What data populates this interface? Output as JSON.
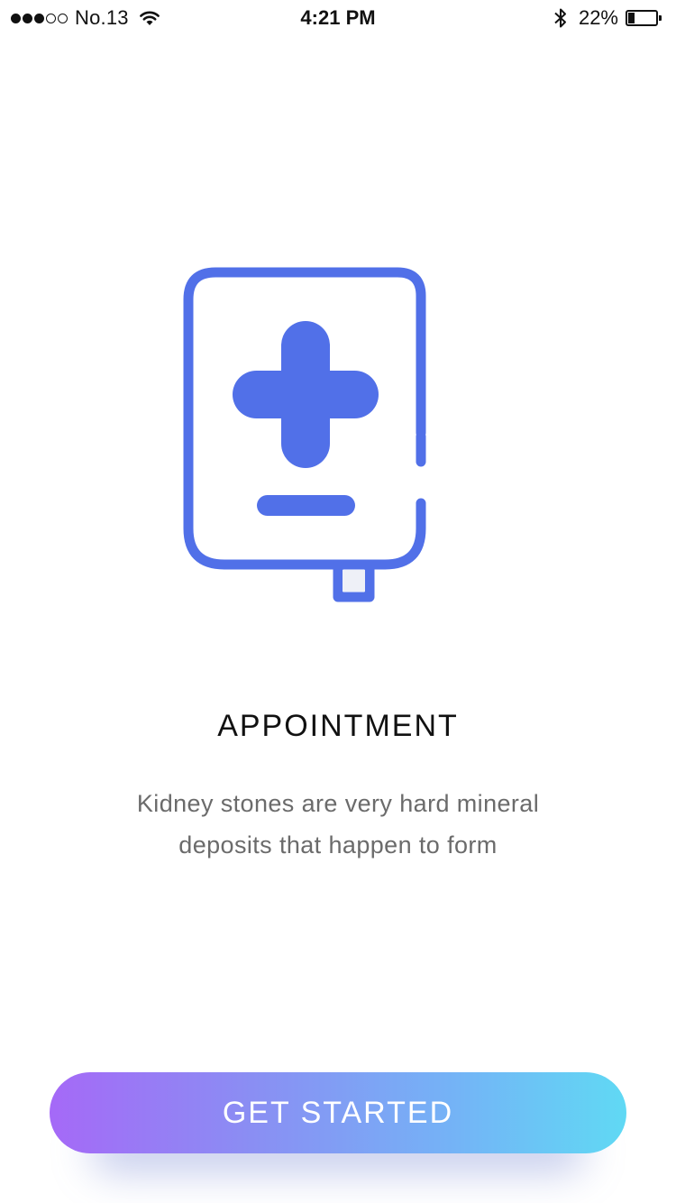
{
  "status_bar": {
    "carrier": "No.13",
    "time": "4:21 PM",
    "battery_percent": "22%",
    "battery_level": 0.22,
    "signal_bars_filled": 3,
    "signal_bars_total": 5
  },
  "illustration": {
    "icon": "medical-book-icon",
    "color": "#5170e8"
  },
  "onboarding": {
    "title": "APPOINTMENT",
    "description": "Kidney stones are very hard mineral deposits that happen to form"
  },
  "actions": {
    "get_started_label": "GET STARTED",
    "gradient_start": "#a569f7",
    "gradient_end": "#60d9f4"
  }
}
